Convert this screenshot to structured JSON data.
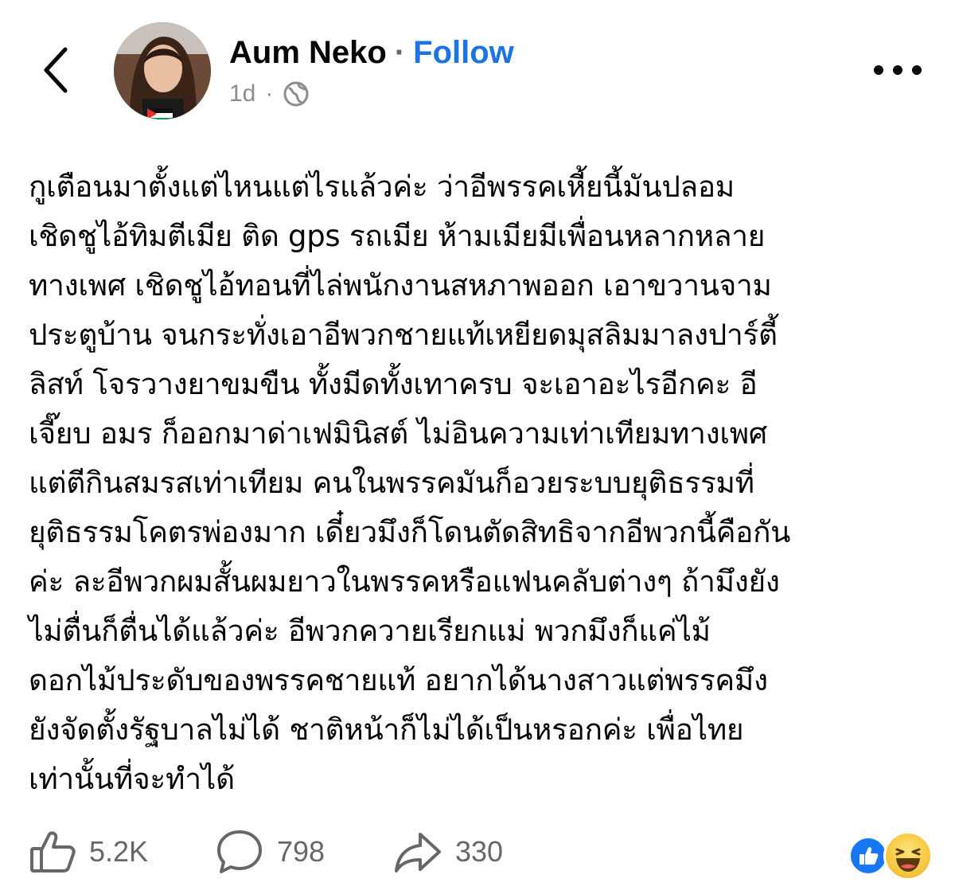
{
  "header": {
    "author_name": "Aum Neko",
    "separator": "·",
    "follow_label": "Follow",
    "timestamp": "1d",
    "meta_separator": "·",
    "privacy_icon": "globe-icon",
    "more_icon": "more-dots-icon",
    "back_icon": "chevron-left-icon"
  },
  "post": {
    "lines": [
      "กูเตือนมาตั้งแต่ไหนแต่ไรแล้วค่ะ ว่าอีพรรคเหี้ยนี้มันปลอม",
      "เชิดชูไอ้ทิมตีเมีย ติด gps รถเมีย ห้ามเมียมีเพื่อนหลากหลาย",
      "ทางเพศ เชิดชูไอ้ทอนที่ไล่พนักงานสหภาพออก เอาขวานจาม",
      "ประตูบ้าน จนกระทั่งเอาอีพวกชายแท้เหยียดมุสลิมมาลงปาร์ตี้",
      "ลิสท์ โจรวางยาขมขืน ทั้งมีดทั้งเทาครบ จะเอาอะไรอีกคะ อี",
      "เจี๊ยบ อมร ก็ออกมาด่าเฟมินิสต์ ไม่อินความเท่าเทียมทางเพศ",
      "แต่ตีกินสมรสเท่าเทียม คนในพรรคมันก็อวยระบบยุติธรรมที่",
      "ยุติธรรมโคตรพ่องมาก เดี๋ยวมึงก็โดนตัดสิทธิจากอีพวกนี้คือกัน",
      "ค่ะ ละอีพวกผมสั้นผมยาวในพรรคหรือแฟนคลับต่างๆ ถ้ามึงยัง",
      "ไม่ตื่นก็ตื่นได้แล้วค่ะ อีพวกควายเรียกแม่ พวกมึงก็แค่ไม้",
      "ดอกไม้ประดับของพรรคชายแท้ อยากได้นางสาวแต่พรรคมึง",
      "ยังจัดตั้งรัฐบาลไม่ได้ ชาติหน้าก็ไม่ได้เป็นหรอกค่ะ เพื่อไทย",
      "เท่านั้นที่จะทำได้"
    ]
  },
  "footer": {
    "likes": "5.2K",
    "comments": "798",
    "shares": "330",
    "like_icon": "thumbs-up-icon",
    "comment_icon": "comment-bubble-icon",
    "share_icon": "share-arrow-icon",
    "reactions": [
      "like-reaction-icon",
      "haha-reaction-icon"
    ]
  },
  "colors": {
    "follow": "#1b74e4",
    "text": "#050505",
    "muted": "#65676b",
    "like_reaction": "#1877f2"
  }
}
